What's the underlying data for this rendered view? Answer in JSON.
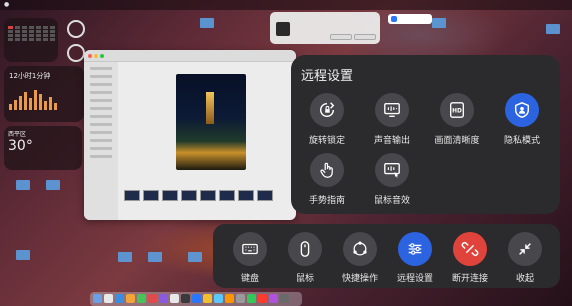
{
  "remote_settings": {
    "title": "远程设置",
    "options": [
      {
        "key": "rotation_lock",
        "label": "旋转锁定",
        "icon": "rotation-lock-icon",
        "active": false
      },
      {
        "key": "audio_output",
        "label": "声音输出",
        "icon": "audio-output-icon",
        "active": false
      },
      {
        "key": "picture_quality",
        "label": "画面清晰度",
        "icon": "hd-icon",
        "active": false
      },
      {
        "key": "privacy_mode",
        "label": "隐私模式",
        "icon": "privacy-shield-icon",
        "active": true
      },
      {
        "key": "gesture_guide",
        "label": "手势指南",
        "icon": "hand-gesture-icon",
        "active": false
      },
      {
        "key": "mouse_sound",
        "label": "鼠标音效",
        "icon": "mouse-sound-icon",
        "active": false
      }
    ]
  },
  "toolbar": {
    "items": [
      {
        "key": "keyboard",
        "label": "键盘",
        "icon": "keyboard-icon",
        "style": "default"
      },
      {
        "key": "mouse",
        "label": "鼠标",
        "icon": "mouse-icon",
        "style": "default"
      },
      {
        "key": "quick_actions",
        "label": "快捷操作",
        "icon": "quick-actions-icon",
        "style": "default"
      },
      {
        "key": "remote_settings",
        "label": "远程设置",
        "icon": "sliders-icon",
        "style": "active"
      },
      {
        "key": "disconnect",
        "label": "断开连接",
        "icon": "disconnect-icon",
        "style": "danger"
      },
      {
        "key": "collapse",
        "label": "收起",
        "icon": "collapse-icon",
        "style": "default"
      }
    ]
  },
  "desktop": {
    "clock_widget_title": "12小时1分钟",
    "weather_temp": "30°",
    "weather_city": "西平区"
  },
  "colors": {
    "panel_bg": "#2b2b2e",
    "button_bg": "#47474c",
    "accent_blue": "#2c63e0",
    "danger_red": "#e0433b"
  }
}
